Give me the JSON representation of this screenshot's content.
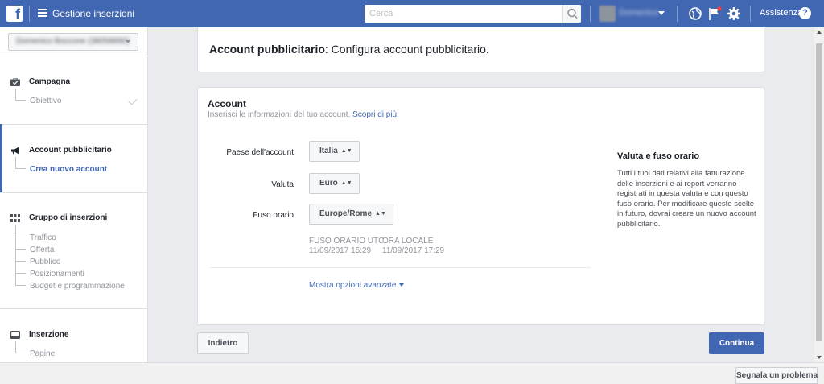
{
  "topbar": {
    "logo": "f",
    "app_title": "Gestione inserzioni",
    "search_placeholder": "Cerca",
    "user_name": "Domenico",
    "help_label": "Assistenza",
    "help_icon_glyph": "?",
    "icons": [
      "menu-icon",
      "search-icon",
      "globe-icon",
      "flag-icon",
      "gear-icon",
      "help-icon"
    ]
  },
  "sidebar": {
    "account_selector": "Domenico Boccone (38058890)",
    "sections": [
      {
        "label": "Campagna",
        "icon": "briefcase-icon",
        "items": [
          "Obiettivo"
        ]
      },
      {
        "label": "Account pubblicitario",
        "icon": "megaphone-icon",
        "items": [
          "Crea nuovo account"
        ]
      },
      {
        "label": "Gruppo di inserzioni",
        "icon": "grid-icon",
        "items": [
          "Traffico",
          "Offerta",
          "Pubblico",
          "Posizionamenti",
          "Budget e programmazione"
        ]
      },
      {
        "label": "Inserzione",
        "icon": "monitor-icon",
        "items": [
          "Pagine"
        ]
      }
    ]
  },
  "header_card": {
    "title_bold": "Account pubblicitario",
    "title_rest": ": Configura account pubblicitario."
  },
  "account_card": {
    "title": "Account",
    "description": "Inserisci le informazioni del tuo account.",
    "learn_more": "Scopri di più.",
    "fields": [
      {
        "label": "Paese dell'account",
        "value": "Italia"
      },
      {
        "label": "Valuta",
        "value": "Euro"
      },
      {
        "label": "Fuso orario",
        "value": "Europe/Rome"
      }
    ],
    "timezone_utc_label": "Fuso orario UTC",
    "timezone_utc_value": "11/09/2017 15:29",
    "local_time_label": "Ora locale",
    "local_time_value": "11/09/2017 17:29",
    "advanced_link": "Mostra opzioni avanzate",
    "side_title": "Valuta e fuso orario",
    "side_text": "Tutti i tuoi dati relativi alla fatturazione delle inserzioni e ai report verranno registrati in questa valuta e con questo fuso orario. Per modificare queste scelte in futuro, dovrai creare un nuovo account pubblicitario."
  },
  "footer": {
    "back_label": "Indietro",
    "continue_label": "Continua",
    "report_label": "Segnala un problema"
  },
  "colors": {
    "brand": "#4267b2",
    "page_bg": "#e9ebee",
    "muted_text": "#90949c"
  }
}
